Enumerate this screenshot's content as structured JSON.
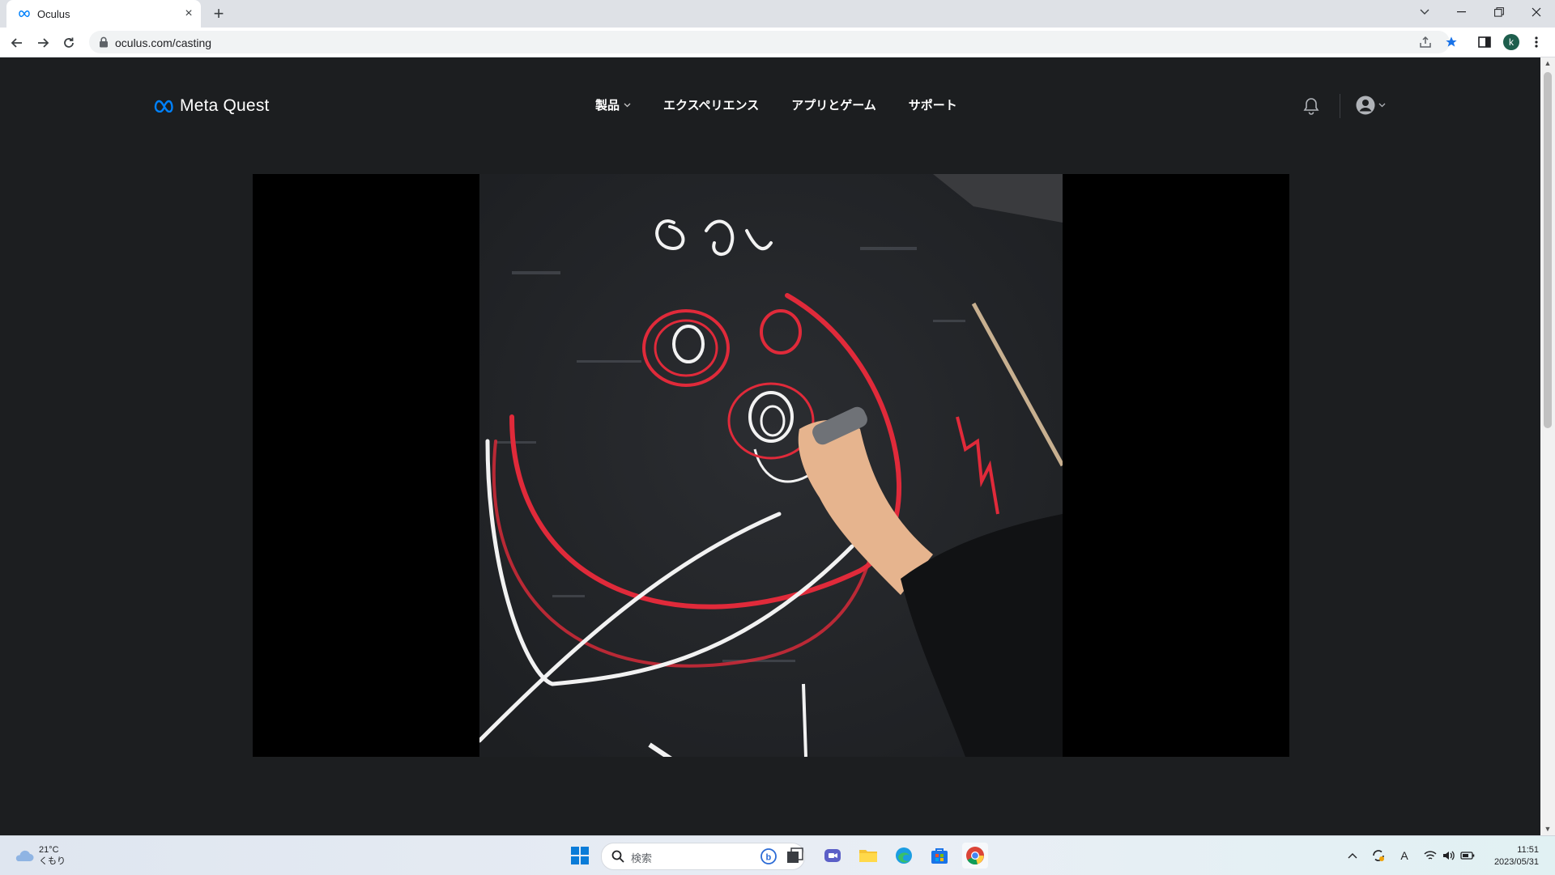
{
  "browser": {
    "tab_title": "Oculus",
    "url": "oculus.com/casting"
  },
  "header": {
    "logo_text": "Meta Quest",
    "nav": [
      {
        "label": "製品",
        "has_dropdown": true
      },
      {
        "label": "エクスペリエンス"
      },
      {
        "label": "アプリとゲーム"
      },
      {
        "label": "サポート"
      }
    ]
  },
  "icons": {
    "tab_favicon": "meta-infinity-icon",
    "logo": "meta-infinity-icon",
    "bell": "notification-bell-icon",
    "account": "account-circle-icon"
  },
  "colors": {
    "page_bg": "#1c1e20",
    "meta_blue": "#0081fb",
    "video_bg": "#000000"
  },
  "video": {
    "description_shapes": "casting view"
  },
  "taskbar": {
    "temperature": "21°C",
    "condition": "くもり",
    "search_placeholder": "検索",
    "time": "11:51",
    "date": "2023/05/31"
  }
}
